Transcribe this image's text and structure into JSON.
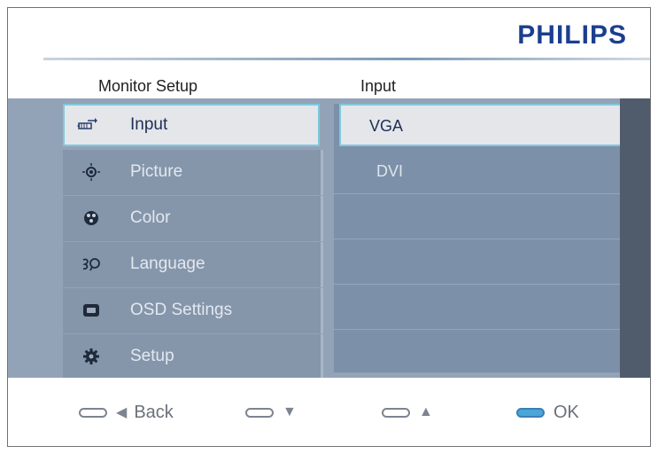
{
  "brand": "PHILIPS",
  "header": {
    "left_title": "Monitor Setup",
    "right_title": "Input"
  },
  "menu": [
    {
      "label": "Input",
      "icon": "input-icon",
      "selected": true
    },
    {
      "label": "Picture",
      "icon": "picture-icon",
      "selected": false
    },
    {
      "label": "Color",
      "icon": "color-icon",
      "selected": false
    },
    {
      "label": "Language",
      "icon": "language-icon",
      "selected": false
    },
    {
      "label": "OSD Settings",
      "icon": "osd-settings-icon",
      "selected": false
    },
    {
      "label": "Setup",
      "icon": "setup-icon",
      "selected": false
    }
  ],
  "submenu": [
    {
      "label": "VGA",
      "selected": true
    },
    {
      "label": "DVI",
      "selected": false
    },
    {
      "label": "",
      "selected": false
    },
    {
      "label": "",
      "selected": false
    },
    {
      "label": "",
      "selected": false
    },
    {
      "label": "",
      "selected": false
    }
  ],
  "footer": {
    "back_label": "Back",
    "ok_label": "OK",
    "back_glyph": "◀",
    "down_glyph": "▼",
    "up_glyph": "▲"
  },
  "colors": {
    "accent": "#7fc8dd",
    "brand": "#1b3f8f",
    "ok_button": "#4aa6d8"
  }
}
